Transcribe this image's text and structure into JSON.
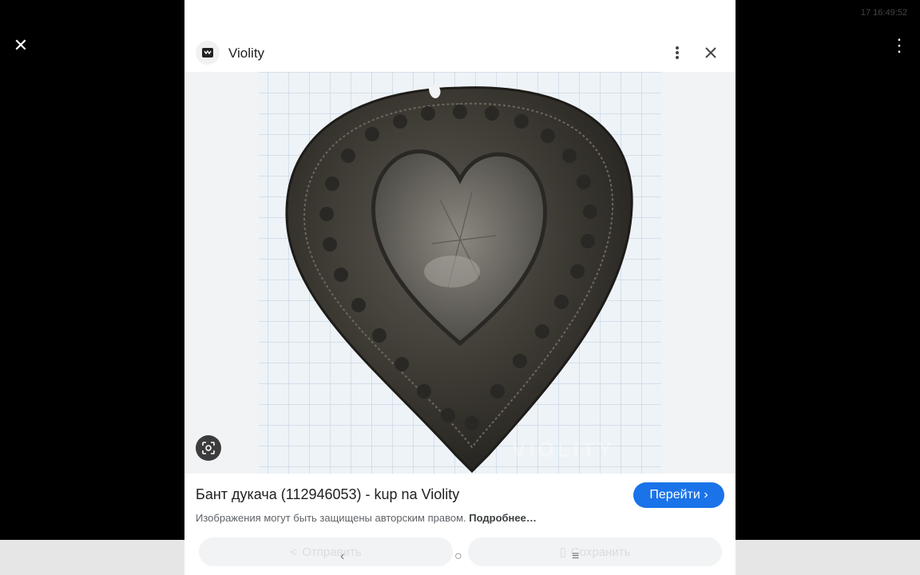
{
  "status_bar": {
    "time_text": "17 16:49:52"
  },
  "outer": {
    "close_icon": "close-icon",
    "more_icon": "more-vert-icon"
  },
  "panel": {
    "site_name": "Violity",
    "image_watermark": "VIOLITY",
    "title": "Бант дукача (112946053) - kup na Violity",
    "visit_label": "Перейти ›",
    "copyright_text": "Изображения могут быть защищены авторским правом.",
    "copyright_link": "Подробнее…",
    "share_label": "Отправить",
    "save_label": "Сохранить"
  },
  "navbar": {
    "back": "‹",
    "home": "○",
    "recents": "≡"
  },
  "colors": {
    "accent": "#1a73e8",
    "background": "#000000"
  }
}
